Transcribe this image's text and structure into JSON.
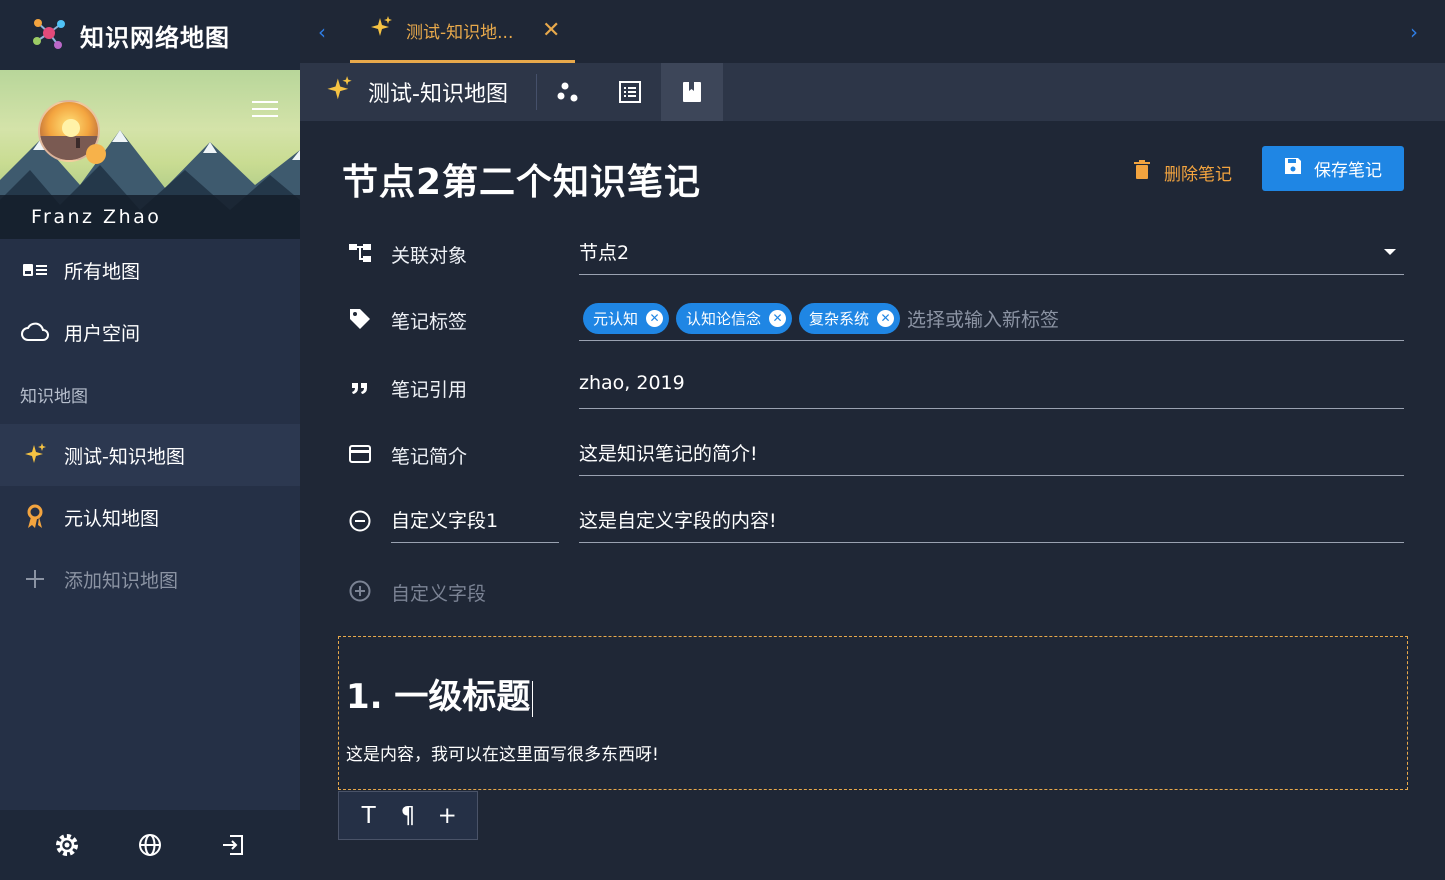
{
  "app": {
    "title": "知识网络地图"
  },
  "user": {
    "name": "Franz Zhao"
  },
  "sidebar": {
    "items": [
      {
        "label": "所有地图",
        "icon": "id-card-icon"
      },
      {
        "label": "用户空间",
        "icon": "cloud-icon"
      }
    ],
    "section_label": "知识地图",
    "maps": [
      {
        "label": "测试-知识地图",
        "icon": "sparkles-icon",
        "active": true
      },
      {
        "label": "元认知地图",
        "icon": "ribbon-icon",
        "active": false
      }
    ],
    "add_map_label": "添加知识地图",
    "footer_icons": [
      "gear-icon",
      "globe-icon",
      "logout-icon"
    ]
  },
  "tabs": [
    {
      "label": "测试-知识地...",
      "icon": "sparkles-icon"
    }
  ],
  "toolbar": {
    "map_title": "测试-知识地图",
    "views": [
      "graph-view-icon",
      "list-view-icon",
      "note-view-icon"
    ]
  },
  "note": {
    "title": "节点2第二个知识笔记",
    "delete_label": "删除笔记",
    "save_label": "保存笔记",
    "fields": {
      "related": {
        "label": "关联对象",
        "value": "节点2"
      },
      "tags": {
        "label": "笔记标签",
        "chips": [
          "元认知",
          "认知论信念",
          "复杂系统"
        ],
        "placeholder": "选择或输入新标签"
      },
      "citation": {
        "label": "笔记引用",
        "value": "zhao, 2019"
      },
      "summary": {
        "label": "笔记简介",
        "value": "这是知识笔记的简介!"
      },
      "custom": {
        "label": "自定义字段1",
        "value": "这是自定义字段的内容!"
      }
    },
    "add_custom_label": "自定义字段",
    "editor": {
      "heading": "1. 一级标题",
      "body": "这是内容，我可以在这里面写很多东西呀!"
    },
    "editor_tools": [
      "T",
      "¶",
      "+"
    ]
  },
  "colors": {
    "accent": "#e8a94b",
    "primary": "#1f86e4",
    "background": "#1f2736",
    "sidebar": "#253046"
  }
}
